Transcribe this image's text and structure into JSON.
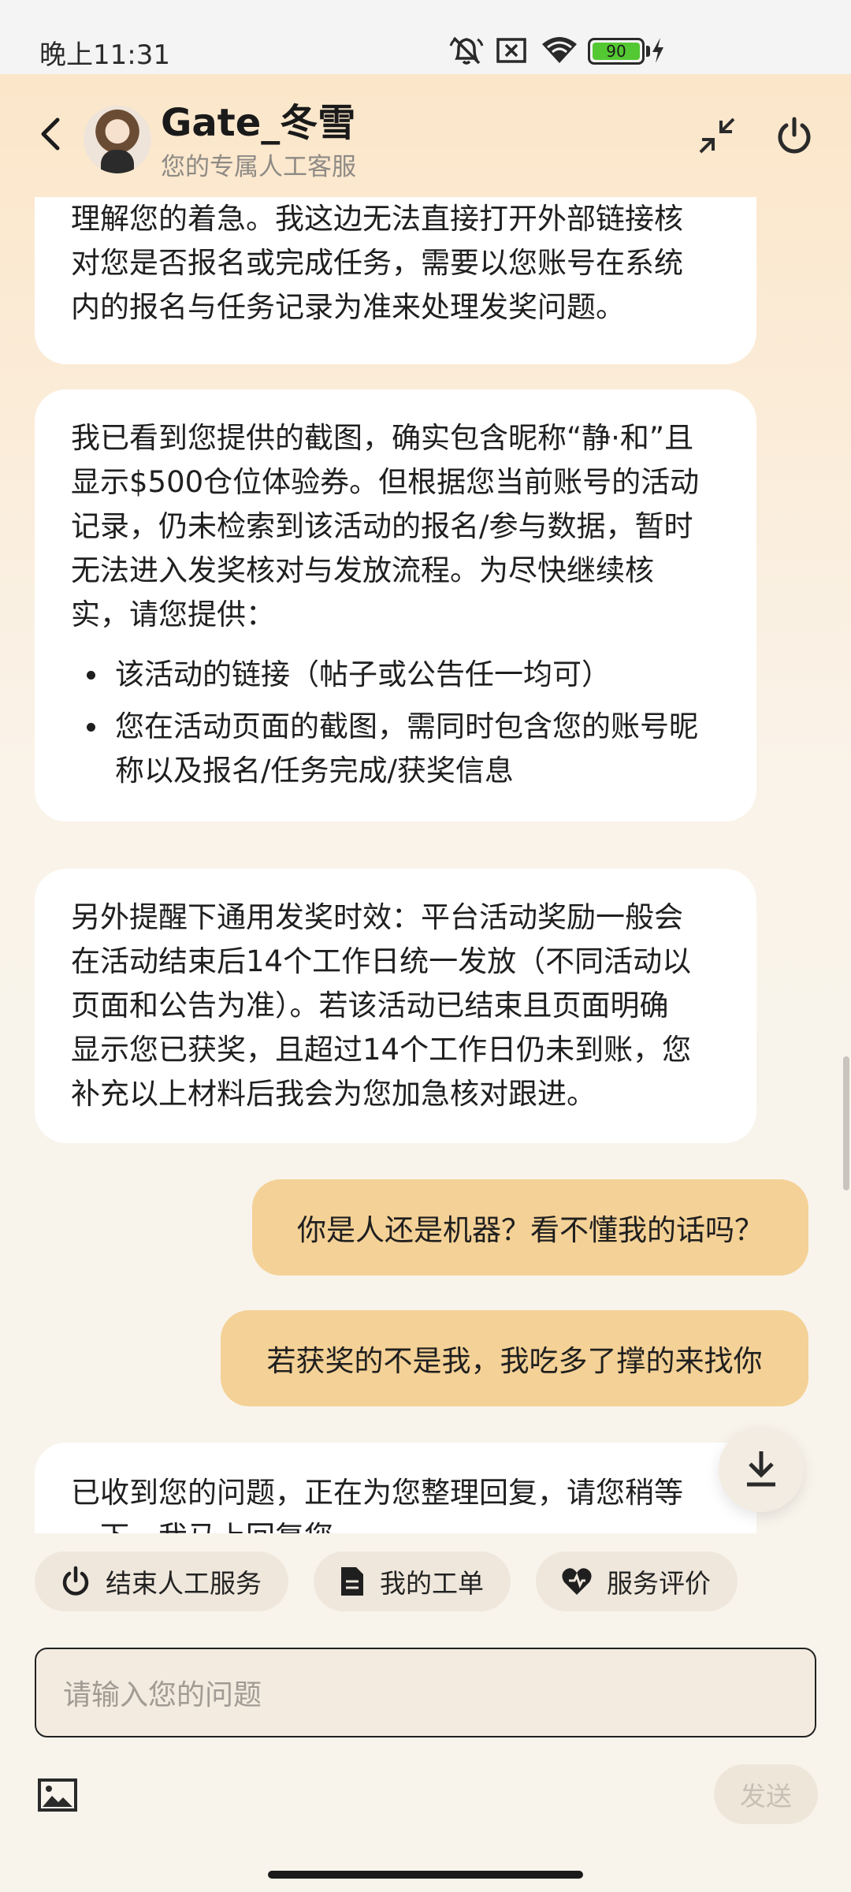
{
  "status_bar": {
    "time": "晚上11:31",
    "battery": "90",
    "icons": [
      "mute-bell-icon",
      "sim-off-icon",
      "wifi-icon",
      "battery-icon",
      "charging-icon"
    ]
  },
  "header": {
    "agent_name": "Gate_冬雪",
    "agent_subtitle": "您的专属人工客服"
  },
  "messages": [
    {
      "role": "agent",
      "lines": [
        "理解您的着急。我这边无法直接打开外部链接核",
        "对您是否报名或完成任务，需要以您账号在系统",
        "内的报名与任务记录为准来处理发奖问题。"
      ]
    },
    {
      "role": "agent",
      "lines": [
        "我已看到您提供的截图，确实包含昵称“静·和”且",
        "显示$500仓位体验券。但根据您当前账号的活动",
        "记录，仍未检索到该活动的报名/参与数据，暂时",
        "无法进入发奖核对与发放流程。为尽快继续核",
        "实，请您提供："
      ],
      "bullets": [
        [
          "该活动的链接（帖子或公告任一均可）"
        ],
        [
          "您在活动页面的截图，需同时包含您的账号昵",
          "称以及报名/任务完成/获奖信息"
        ]
      ]
    },
    {
      "role": "agent",
      "lines": [
        "另外提醒下通用发奖时效：平台活动奖励一般会",
        "在活动结束后14个工作日统一发放（不同活动以",
        "页面和公告为准）。若该活动已结束且页面明确",
        "显示您已获奖，且超过14个工作日仍未到账，您",
        "补充以上材料后我会为您加急核对跟进。"
      ]
    },
    {
      "role": "user",
      "text": "你是人还是机器？看不懂我的话吗？"
    },
    {
      "role": "user",
      "text": "若获奖的不是我，我吃多了撑的来找你"
    },
    {
      "role": "agent",
      "lines": [
        "已收到您的问题，正在为您整理回复，请您稍等",
        "一下，我马上回复您。"
      ]
    }
  ],
  "quick_actions": [
    {
      "label": "结束人工服务",
      "icon": "power-icon"
    },
    {
      "label": "我的工单",
      "icon": "ticket-icon"
    },
    {
      "label": "服务评价",
      "icon": "heart-rating-icon"
    }
  ],
  "input": {
    "placeholder": "请输入您的问题"
  },
  "send_label": "发送",
  "colors": {
    "accent": "#f4d196",
    "user_bubble": "#f4d196",
    "agent_bubble": "#ffffff"
  }
}
